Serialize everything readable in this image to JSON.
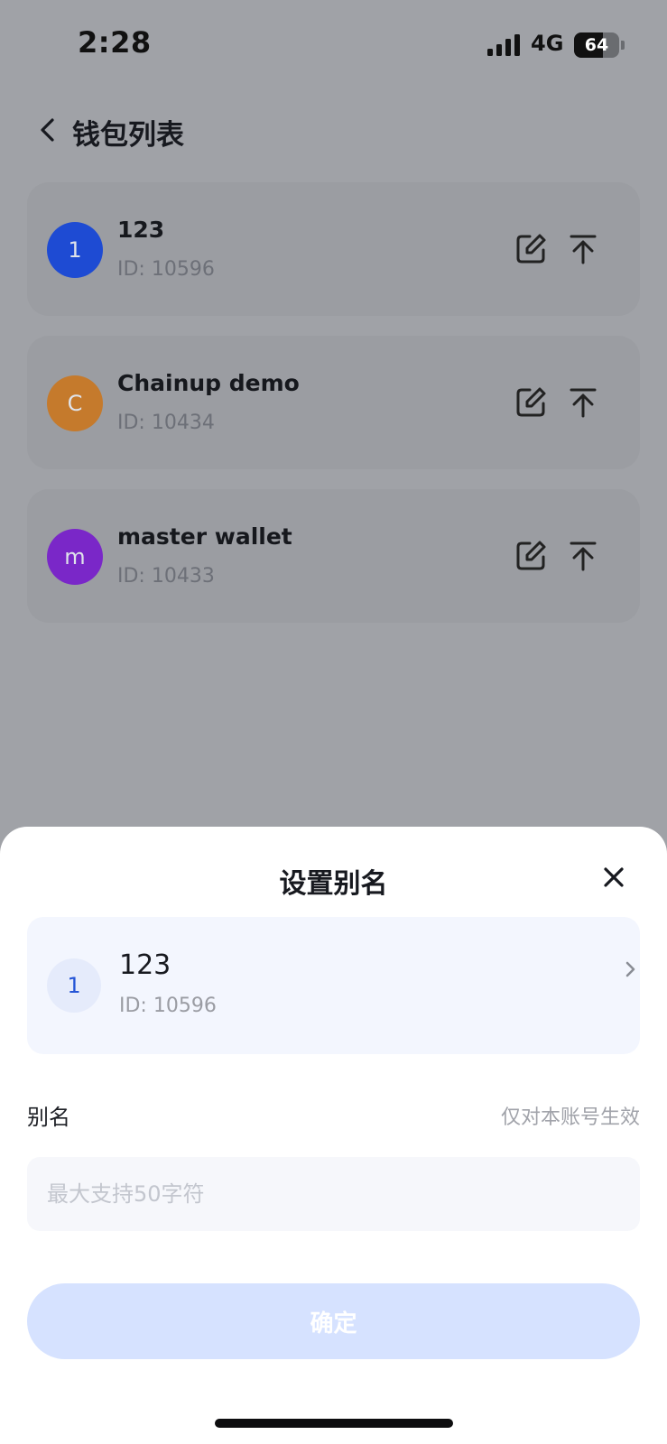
{
  "status_bar": {
    "time": "2:28",
    "network": "4G",
    "battery": "64",
    "battery_level_percent": 64
  },
  "header": {
    "title": "钱包列表",
    "back_icon": "chevron-left-icon"
  },
  "wallets": [
    {
      "avatar_letter": "1",
      "avatar_color": "#1e4bd3",
      "name": "123",
      "id": "ID: 10596"
    },
    {
      "avatar_letter": "C",
      "avatar_color": "#c57a2c",
      "name": "Chainup demo",
      "id": "ID: 10434"
    },
    {
      "avatar_letter": "m",
      "avatar_color": "#7a27c8",
      "name": "master wallet",
      "id": "ID: 10433"
    }
  ],
  "icons": {
    "edit": "edit-icon",
    "pin_top": "pin-to-top-icon",
    "close": "close-icon",
    "chevron_right": "chevron-right-icon"
  },
  "sheet": {
    "title": "设置别名",
    "selected_wallet": {
      "avatar_letter": "1",
      "name": "123",
      "id": "ID: 10596"
    },
    "alias_label": "别名",
    "alias_hint": "仅对本账号生效",
    "alias_input": {
      "value": "",
      "placeholder": "最大支持50字符"
    },
    "confirm_label": "确定"
  },
  "colors": {
    "overlay_background": "#a0a2a7",
    "card_background": "#9b9da2",
    "sheet_background": "#ffffff",
    "selected_card_background": "#f3f6fe",
    "confirm_button_disabled": "#d6e2ff",
    "accent_blue": "#2454d6"
  }
}
